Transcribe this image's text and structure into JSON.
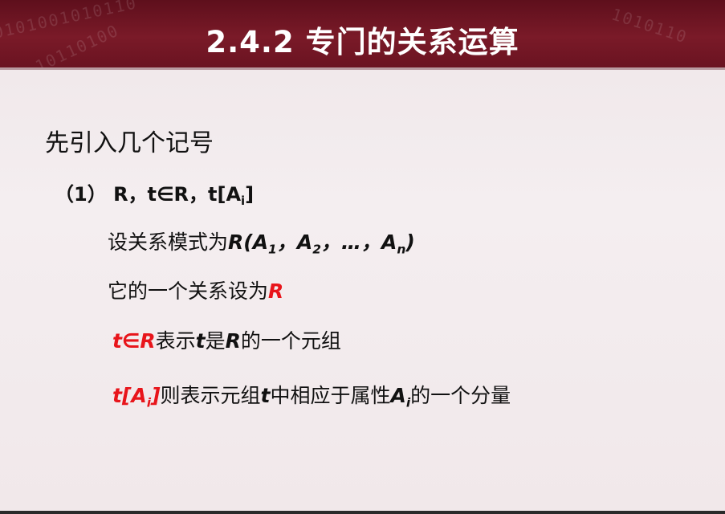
{
  "slide": {
    "title": "2.4.2 专门的关系运算",
    "intro": "先引入几个记号",
    "item": {
      "number": "（1）",
      "R": "R",
      "comma1": "，",
      "t": "t",
      "elem": "∈",
      "R2": "R",
      "comma2": "，",
      "tA": "t[A",
      "sub_i": "i",
      "close": "]"
    },
    "line1": {
      "prefix": "设关系模式为",
      "R": "R(A",
      "sub1": "1",
      "sep1": "，A",
      "sub2": "2",
      "sep2": "，…，A",
      "subn": "n",
      "close": ")"
    },
    "line2": {
      "prefix": "它的一个关系设为",
      "R": "R"
    },
    "line3": {
      "t_in_R": "t∈R",
      "text1": "表示",
      "t": "t",
      "text2": "是",
      "R": "R",
      "text3": "的一个元组"
    },
    "line4": {
      "tA": "t[A",
      "sub_i": "i",
      "close": "]",
      "text1": "则表示元组",
      "t": "t",
      "text2": "中相应于属性",
      "A": "A",
      "sub_i2": "i",
      "text3": "的一个分量"
    },
    "header_decoration": {
      "binary1": "0101001010110",
      "binary2": "1010110",
      "binary3": "10110100"
    }
  },
  "colors": {
    "header": "#7a1a28",
    "accent_red": "#e8151b",
    "text": "#111111",
    "background": "#f2eaec"
  }
}
